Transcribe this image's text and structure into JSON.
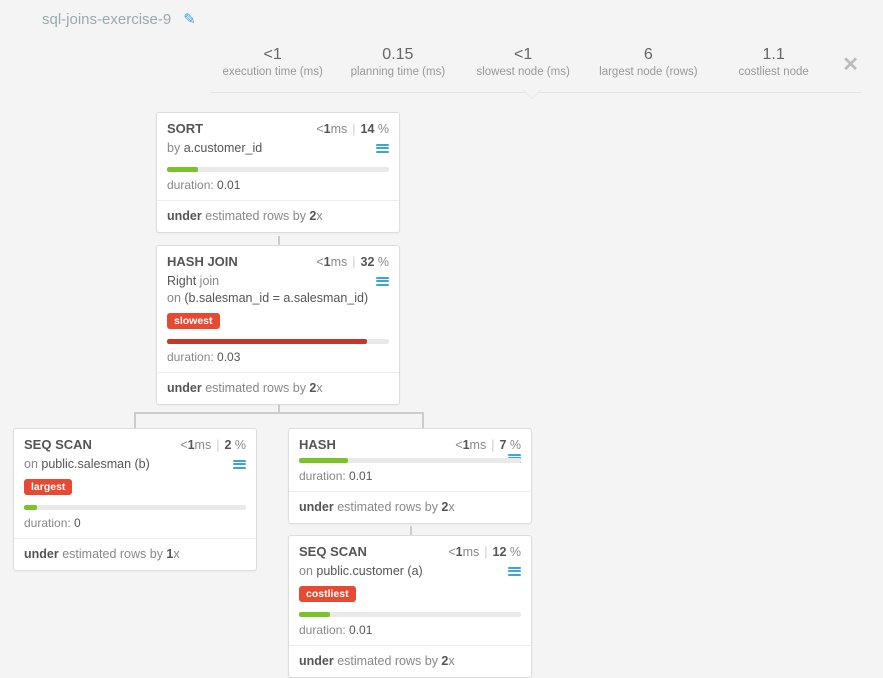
{
  "title": "sql-joins-exercise-9",
  "stats": [
    {
      "value": "<1",
      "label": "execution time (ms)"
    },
    {
      "value": "0.15",
      "label": "planning time (ms)"
    },
    {
      "value": "<1",
      "label": "slowest node (ms)"
    },
    {
      "value": "6",
      "label": "largest node (rows)"
    },
    {
      "value": "1.1",
      "label": "costliest node"
    }
  ],
  "nodes": {
    "sort": {
      "name": "SORT",
      "time_prefix": "<",
      "time_val": "1",
      "time_unit": "ms",
      "pct": "14",
      "desc_prefix": "by ",
      "desc_key": "a.customer_id",
      "bar_pct": "14",
      "bar_color": "green",
      "duration_label": "duration: ",
      "duration": "0.01",
      "est_word": "under",
      "est_mid": " estimated rows by ",
      "est_factor": "2",
      "est_x": "x"
    },
    "hashjoin": {
      "name": "HASH JOIN",
      "time_prefix": "<",
      "time_val": "1",
      "time_unit": "ms",
      "pct": "32",
      "desc_key": "Right",
      "desc_suffix": " join",
      "desc_line2_prefix": "on ",
      "desc_line2_key": "(b.salesman_id = a.salesman_id)",
      "tag": "slowest",
      "bar_pct": "90",
      "bar_color": "red",
      "duration_label": "duration: ",
      "duration": "0.03",
      "est_word": "under",
      "est_mid": " estimated rows by ",
      "est_factor": "2",
      "est_x": "x"
    },
    "seqscan1": {
      "name": "SEQ SCAN",
      "time_prefix": "<",
      "time_val": "1",
      "time_unit": "ms",
      "pct": "2",
      "desc_prefix": "on ",
      "desc_key": "public.salesman (b)",
      "tag": "largest",
      "bar_pct": "6",
      "bar_color": "green",
      "duration_label": "duration: ",
      "duration": "0",
      "est_word": "under",
      "est_mid": " estimated rows by ",
      "est_factor": "1",
      "est_x": "x"
    },
    "hash": {
      "name": "HASH",
      "time_prefix": "<",
      "time_val": "1",
      "time_unit": "ms",
      "pct": "7",
      "bar_pct": "22",
      "bar_color": "green",
      "duration_label": "duration: ",
      "duration": "0.01",
      "est_word": "under",
      "est_mid": " estimated rows by ",
      "est_factor": "2",
      "est_x": "x"
    },
    "seqscan2": {
      "name": "SEQ SCAN",
      "time_prefix": "<",
      "time_val": "1",
      "time_unit": "ms",
      "pct": "12",
      "desc_prefix": "on ",
      "desc_key": "public.customer (a)",
      "tag": "costliest",
      "bar_pct": "14",
      "bar_color": "green",
      "duration_label": "duration: ",
      "duration": "0.01",
      "est_word": "under",
      "est_mid": " estimated rows by ",
      "est_factor": "2",
      "est_x": "x"
    }
  },
  "pct_sign": " %"
}
